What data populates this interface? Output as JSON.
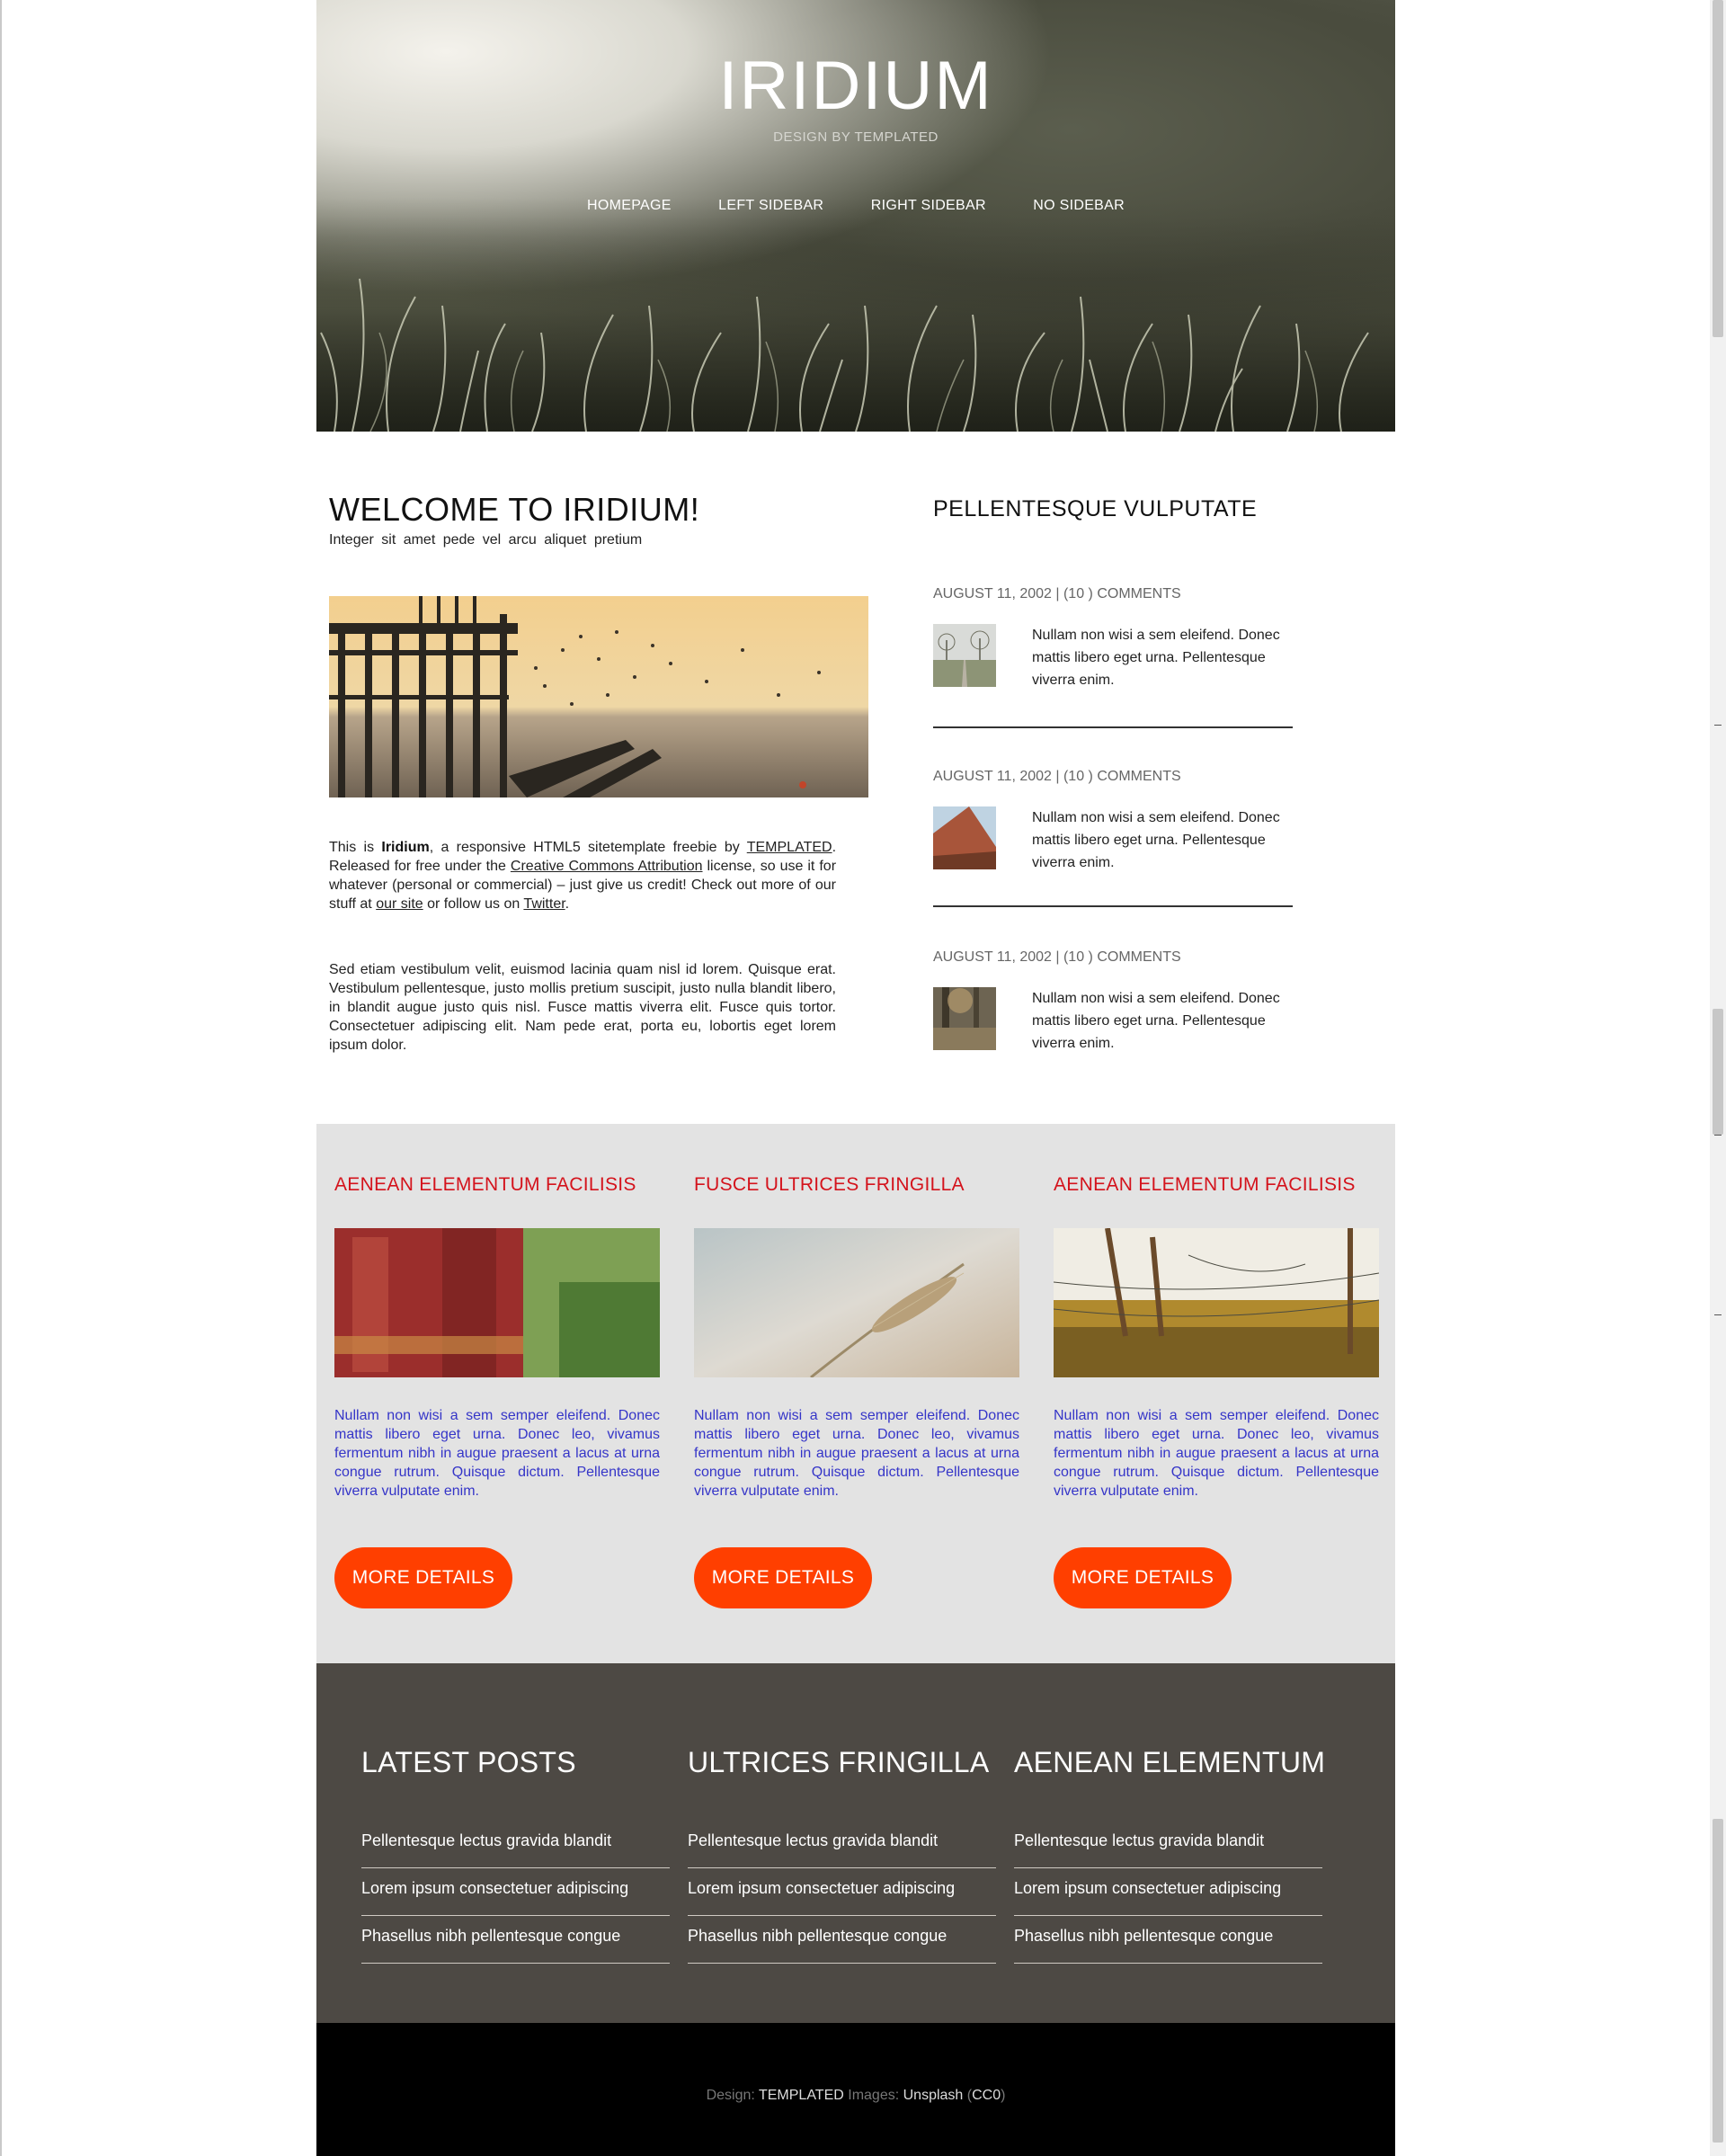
{
  "header": {
    "title": "IRIDIUM",
    "subtitle": "DESIGN BY TEMPLATED",
    "nav": [
      "HOMEPAGE",
      "LEFT SIDEBAR",
      "RIGHT SIDEBAR",
      "NO SIDEBAR"
    ]
  },
  "main": {
    "title": "WELCOME TO IRIDIUM!",
    "subtitle": "Integer sit amet pede vel arcu aliquet pretium",
    "intro": {
      "t1": "This is ",
      "brand": "Iridium",
      "t2": ", a responsive HTML5 sitetemplate freebie by ",
      "link_templated": "TEMPLATED",
      "t3": ". Released for free under the ",
      "link_license": "Creative Commons Attribution",
      "t4": " license, so use it for whatever (personal or commercial) – just give us credit! Check out more of our stuff at ",
      "link_site": "our site",
      "t5": " or follow us on ",
      "link_twitter": "Twitter",
      "t6": "."
    },
    "paragraph2": "Sed etiam vestibulum velit, euismod lacinia quam nisl id lorem. Quisque erat. Vestibulum pellentesque, justo mollis pretium suscipit, justo nulla blandit libero, in blandit augue justo quis nisl. Fusce mattis viverra elit. Fusce quis tortor. Consectetuer adipiscing elit. Nam pede erat, porta eu, lobortis eget lorem ipsum dolor."
  },
  "sidebar": {
    "title": "PELLENTESQUE VULPUTATE",
    "posts": [
      {
        "meta": "AUGUST 11, 2002 | (10 ) COMMENTS",
        "text": "Nullam non wisi a sem eleifend. Donec mattis libero eget urna. Pellentesque viverra enim."
      },
      {
        "meta": "AUGUST 11, 2002 | (10 ) COMMENTS",
        "text": "Nullam non wisi a sem eleifend. Donec mattis libero eget urna. Pellentesque viverra enim."
      },
      {
        "meta": "AUGUST 11, 2002 | (10 ) COMMENTS",
        "text": "Nullam non wisi a sem eleifend. Donec mattis libero eget urna. Pellentesque viverra enim."
      }
    ]
  },
  "features": [
    {
      "title": "AENEAN ELEMENTUM FACILISIS",
      "text": "Nullam non wisi a sem semper eleifend. Donec mattis libero eget urna. Donec leo, vivamus fermentum nibh in augue praesent a lacus at urna congue rutrum. Quisque dictum. Pellentesque viverra vulputate enim.",
      "button": "MORE DETAILS"
    },
    {
      "title": "FUSCE ULTRICES FRINGILLA",
      "text": "Nullam non wisi a sem semper eleifend. Donec mattis libero eget urna. Donec leo, vivamus fermentum nibh in augue praesent a lacus at urna congue rutrum. Quisque dictum. Pellentesque viverra vulputate enim.",
      "button": "MORE DETAILS"
    },
    {
      "title": "AENEAN ELEMENTUM FACILISIS",
      "text": "Nullam non wisi a sem semper eleifend. Donec mattis libero eget urna. Donec leo, vivamus fermentum nibh in augue praesent a lacus at urna congue rutrum. Quisque dictum. Pellentesque viverra vulputate enim.",
      "button": "MORE DETAILS"
    }
  ],
  "footer": {
    "columns": [
      {
        "title": "LATEST POSTS",
        "links": [
          "Pellentesque lectus gravida blandit",
          "Lorem ipsum consectetuer adipiscing",
          "Phasellus nibh pellentesque congue"
        ]
      },
      {
        "title": "ULTRICES FRINGILLA",
        "links": [
          "Pellentesque lectus gravida blandit",
          "Lorem ipsum consectetuer adipiscing",
          "Phasellus nibh pellentesque congue"
        ]
      },
      {
        "title": "AENEAN ELEMENTUM",
        "links": [
          "Pellentesque lectus gravida blandit",
          "Lorem ipsum consectetuer adipiscing",
          "Phasellus nibh pellentesque congue"
        ]
      }
    ],
    "copyright": {
      "design_label": "Design: ",
      "design_link": "TEMPLATED",
      "images_label": " Images: ",
      "images_link": "Unsplash",
      "license_open": " (",
      "license_link": "CC0",
      "license_close": ")"
    }
  },
  "colors": {
    "accent_red": "#d4131c",
    "button_orange": "#ff3f00",
    "feature_text_blue": "#3535c8",
    "features_bg": "#e3e3e3",
    "footer_bg": "#4d4944",
    "copyright_bg": "#000000"
  }
}
